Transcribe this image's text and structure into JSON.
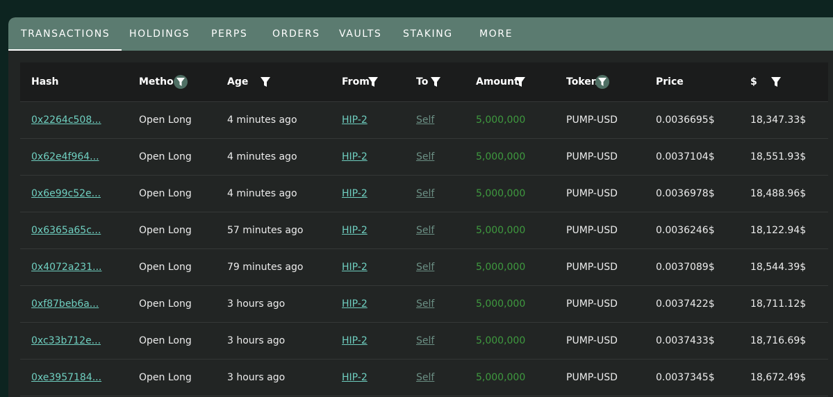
{
  "tabs": [
    {
      "label": "TRANSACTIONS",
      "active": true
    },
    {
      "label": "HOLDINGS",
      "active": false
    },
    {
      "label": "PERPS",
      "active": false
    },
    {
      "label": "ORDERS",
      "active": false
    },
    {
      "label": "VAULTS",
      "active": false
    },
    {
      "label": "STAKING",
      "active": false
    },
    {
      "label": "MORE",
      "active": false
    }
  ],
  "columns": [
    "Hash",
    "Method",
    "Age",
    "From",
    "To",
    "Amount",
    "Token",
    "Price",
    "$"
  ],
  "rows": [
    {
      "hash": "0x2264c508...",
      "method": "Open Long",
      "age": "4 minutes ago",
      "from": "HIP-2",
      "to": "Self",
      "amount": "5,000,000",
      "token": "PUMP-USD",
      "price": "0.0036695$",
      "usd": "18,347.33$"
    },
    {
      "hash": "0x62e4f964...",
      "method": "Open Long",
      "age": "4 minutes ago",
      "from": "HIP-2",
      "to": "Self",
      "amount": "5,000,000",
      "token": "PUMP-USD",
      "price": "0.0037104$",
      "usd": "18,551.93$"
    },
    {
      "hash": "0x6e99c52e...",
      "method": "Open Long",
      "age": "4 minutes ago",
      "from": "HIP-2",
      "to": "Self",
      "amount": "5,000,000",
      "token": "PUMP-USD",
      "price": "0.0036978$",
      "usd": "18,488.96$"
    },
    {
      "hash": "0x6365a65c...",
      "method": "Open Long",
      "age": "57 minutes ago",
      "from": "HIP-2",
      "to": "Self",
      "amount": "5,000,000",
      "token": "PUMP-USD",
      "price": "0.0036246$",
      "usd": "18,122.94$"
    },
    {
      "hash": "0x4072a231...",
      "method": "Open Long",
      "age": "79 minutes ago",
      "from": "HIP-2",
      "to": "Self",
      "amount": "5,000,000",
      "token": "PUMP-USD",
      "price": "0.0037089$",
      "usd": "18,544.39$"
    },
    {
      "hash": "0xf87beb6a...",
      "method": "Open Long",
      "age": "3 hours ago",
      "from": "HIP-2",
      "to": "Self",
      "amount": "5,000,000",
      "token": "PUMP-USD",
      "price": "0.0037422$",
      "usd": "18,711.12$"
    },
    {
      "hash": "0xc33b712e...",
      "method": "Open Long",
      "age": "3 hours ago",
      "from": "HIP-2",
      "to": "Self",
      "amount": "5,000,000",
      "token": "PUMP-USD",
      "price": "0.0037433$",
      "usd": "18,716.69$"
    },
    {
      "hash": "0xe3957184...",
      "method": "Open Long",
      "age": "3 hours ago",
      "from": "HIP-2",
      "to": "Self",
      "amount": "5,000,000",
      "token": "PUMP-USD",
      "price": "0.0037345$",
      "usd": "18,672.49$"
    }
  ],
  "icons": {
    "filter": "filter-icon"
  },
  "colors": {
    "background": "#0d2420",
    "tab_bar": "#5b7b70",
    "table_bg": "#222524",
    "header_bg": "#1b1c1c",
    "link": "#6fcfc0",
    "muted_link": "#6b8f84",
    "amount": "#3f9a3f"
  }
}
